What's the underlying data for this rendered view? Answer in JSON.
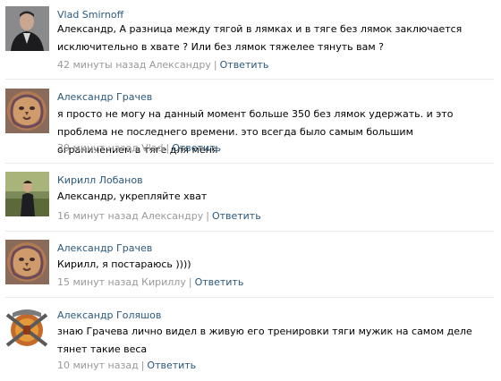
{
  "comments": [
    {
      "author": "Vlad Smirnoff",
      "text": "Александр, А разница между тягой в лямках и в тяге без лямок заключается исключительно в хвате ? Или без лямок тяжелее тянуть вам ?",
      "time": "42 минуты назад Александру",
      "reply": "Ответить",
      "avatar": "man-in-suit-photo"
    },
    {
      "author": "Александр Грачев",
      "text": "я просто не могу на данный момент больше 350 без лямок удержать. и это проблема не последнего времени. это всегда было самым большим ограничением в тяге для меня",
      "time": "39 минут назад Vlad",
      "reply": "Ответить",
      "avatar": "lion-painting"
    },
    {
      "author": "Кирилл Лобанов",
      "text": "Александр, укрепляйте хват",
      "time": "16 минут назад Александру",
      "reply": "Ответить",
      "avatar": "man-outdoors-photo"
    },
    {
      "author": "Александр Грачев",
      "text": "Кирилл, я постараюсь ))))",
      "time": "15 минут назад Кириллу",
      "reply": "Ответить",
      "avatar": "lion-painting"
    },
    {
      "author": "Александр Голяшов",
      "text": "знаю Грачева лично видел в живую его тренировки тяги мужик на самом деле тянет такие веса",
      "time": "10 минут назад",
      "reply": "Ответить",
      "avatar": "emblem-logo"
    }
  ],
  "separator": "|",
  "colors": {
    "link": "#2b587a",
    "meta": "#999999",
    "divider": "#e7ebf0"
  }
}
